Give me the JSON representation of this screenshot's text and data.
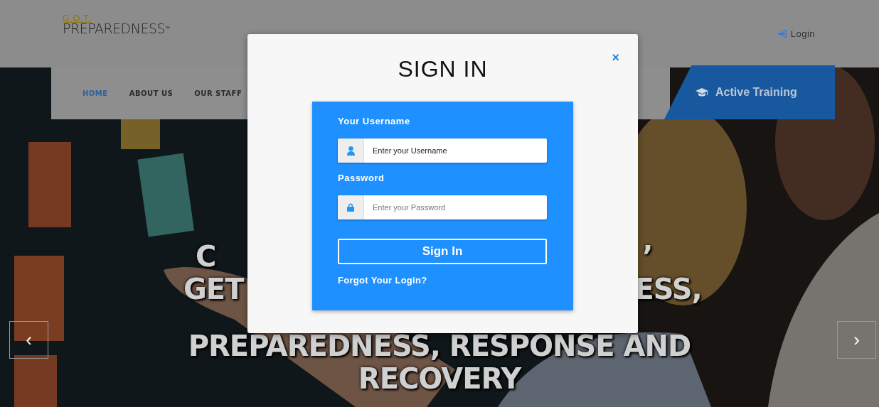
{
  "header": {
    "logo": {
      "top": "G.O.T.",
      "main": "PREPAREDNESS",
      "mark": "™"
    },
    "login_link": "Login"
  },
  "nav": {
    "items": [
      {
        "label": "HOME",
        "selected": true
      },
      {
        "label": "ABOUT US",
        "selected": false
      },
      {
        "label": "OUR STAFF",
        "selected": false
      }
    ],
    "active_training": "Active Training"
  },
  "hero": {
    "lines": [
      {
        "parts": [
          "C",
          "’"
        ]
      },
      {
        "parts": [
          "GET",
          "ESS,"
        ]
      },
      {
        "parts": [
          "PREPAREDNESS, RESPONSE AND"
        ]
      },
      {
        "parts": [
          "RECOVERY"
        ]
      }
    ],
    "prev": "‹",
    "next": "›"
  },
  "modal": {
    "title": "SIGN IN",
    "close": "×",
    "username_label": "Your Username",
    "username_value": "Enter your Username",
    "password_label": "Password",
    "password_placeholder": "Enter your Password",
    "submit": "Sign In",
    "forgot_link": "Forgot Your Login?"
  }
}
